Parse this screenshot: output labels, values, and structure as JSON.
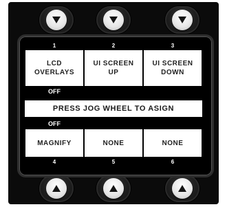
{
  "top_buttons": [
    {
      "icon": "chevron-down-icon"
    },
    {
      "icon": "chevron-down-icon"
    },
    {
      "icon": "chevron-down-icon"
    }
  ],
  "bottom_buttons": [
    {
      "icon": "chevron-up-icon"
    },
    {
      "icon": "chevron-up-icon"
    },
    {
      "icon": "chevron-up-icon"
    }
  ],
  "slots_top": [
    {
      "number": "1",
      "label_line1": "LCD",
      "label_line2": "OVERLAYS",
      "state": "OFF"
    },
    {
      "number": "2",
      "label_line1": "UI SCREEN",
      "label_line2": "UP",
      "state": ""
    },
    {
      "number": "3",
      "label_line1": "UI SCREEN",
      "label_line2": "DOWN",
      "state": ""
    }
  ],
  "banner": "PRESS JOG WHEEL TO ASIGN",
  "slots_bottom": [
    {
      "number": "4",
      "label": "MAGNIFY",
      "state": "OFF"
    },
    {
      "number": "5",
      "label": "NONE",
      "state": ""
    },
    {
      "number": "6",
      "label": "NONE",
      "state": ""
    }
  ],
  "colors": {
    "panel": "#0b0b0b",
    "cell": "#ffffff",
    "text": "#222222"
  }
}
